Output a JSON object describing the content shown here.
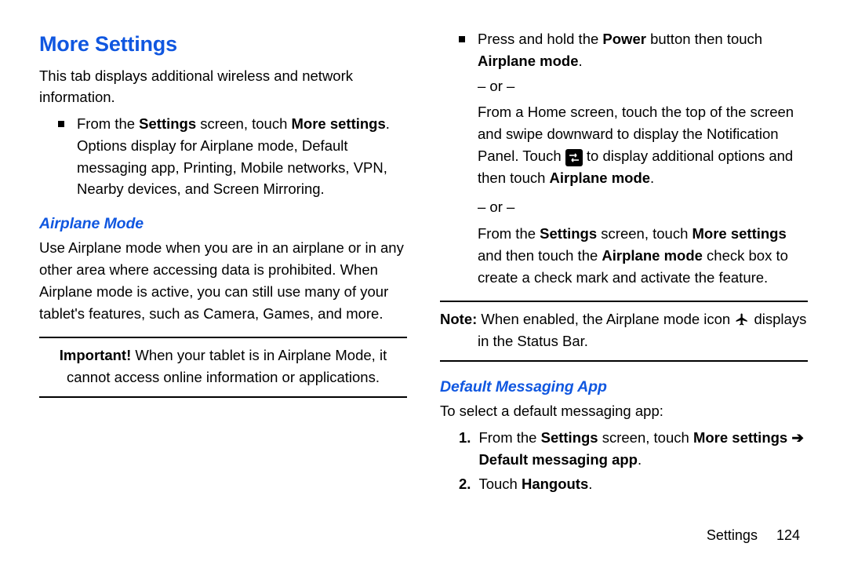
{
  "h1": "More Settings",
  "intro": "This tab displays additional wireless and network information.",
  "bullet1_pre": "From the ",
  "bullet1_b1": "Settings",
  "bullet1_mid": " screen, touch ",
  "bullet1_b2": "More settings",
  "bullet1_post": ".",
  "bullet1_body": "Options display for Airplane mode, Default messaging app, Printing, Mobile networks, VPN, Nearby devices, and Screen Mirroring.",
  "h2_airplane": "Airplane Mode",
  "airplane_body": "Use Airplane mode when you are in an airplane or in any other area where accessing data is prohibited. When Airplane mode is active, you can still use many of your tablet's features, such as Camera, Games, and more.",
  "important_label": "Important!",
  "important_body": " When your tablet is in Airplane Mode, it cannot access online information or applications.",
  "col2": {
    "b1_pre": "Press and hold the ",
    "b1_b1": "Power",
    "b1_mid": " button then touch ",
    "b1_b2": "Airplane mode",
    "b1_post": ".",
    "or": "– or –",
    "p2a": "From a Home screen, touch the top of the screen and swipe downward to display the Notification Panel. Touch ",
    "p2b": " to display additional options and then touch ",
    "p2c": "Airplane mode",
    "p2d": ".",
    "p3_pre": "From the ",
    "p3_b1": "Settings",
    "p3_mid1": " screen, touch ",
    "p3_b2": "More settings",
    "p3_mid2": " and then touch the ",
    "p3_b3": "Airplane mode",
    "p3_post": " check box to create a check mark and activate the feature.",
    "note_label": "Note:",
    "note_a": " When enabled, the Airplane mode icon ",
    "note_b": " displays in the Status Bar."
  },
  "h2_msg": "Default Messaging App",
  "msg_intro": "To select a default messaging app:",
  "step1_num": "1.",
  "step1_pre": "From the ",
  "step1_b1": "Settings",
  "step1_mid": " screen, touch ",
  "step1_b2": "More settings ➔ Default messaging app",
  "step1_post": ".",
  "step2_num": "2.",
  "step2_pre": "Touch ",
  "step2_b1": "Hangouts",
  "step2_post": ".",
  "footer_section": "Settings",
  "footer_page": "124"
}
